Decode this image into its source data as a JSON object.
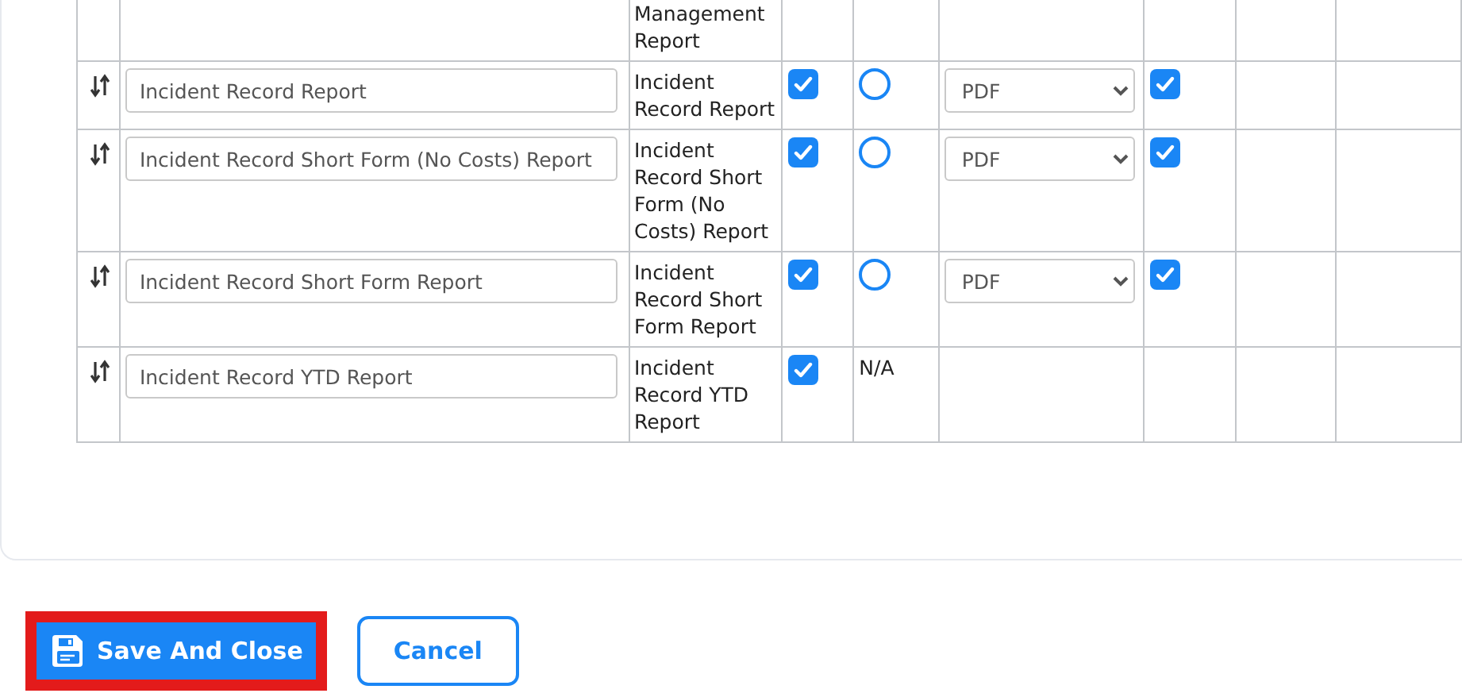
{
  "report_table": {
    "rows": [
      {
        "report_name": "Management Report"
      },
      {
        "name_value": "Incident Record Report",
        "report_name": "Incident Record Report",
        "included": true,
        "option": {
          "kind": "radio",
          "selected": false
        },
        "format": "PDF",
        "emailed": true
      },
      {
        "name_value": "Incident Record Short Form (No Costs) Report",
        "report_name": "Incident Record Short Form (No Costs) Report",
        "included": true,
        "option": {
          "kind": "radio",
          "selected": false
        },
        "format": "PDF",
        "emailed": true
      },
      {
        "name_value": "Incident Record Short Form Report",
        "report_name": "Incident Record Short Form Report",
        "included": true,
        "option": {
          "kind": "radio",
          "selected": false
        },
        "format": "PDF",
        "emailed": true
      },
      {
        "name_value": "Incident Record YTD Report",
        "report_name": "Incident Record YTD Report",
        "included": true,
        "option": {
          "kind": "text",
          "text": "N/A"
        }
      }
    ]
  },
  "buttons": [
    {
      "kind": "primary",
      "label": "Save And Close",
      "highlighted": true
    },
    {
      "kind": "outline",
      "label": "Cancel",
      "highlighted": false
    }
  ]
}
